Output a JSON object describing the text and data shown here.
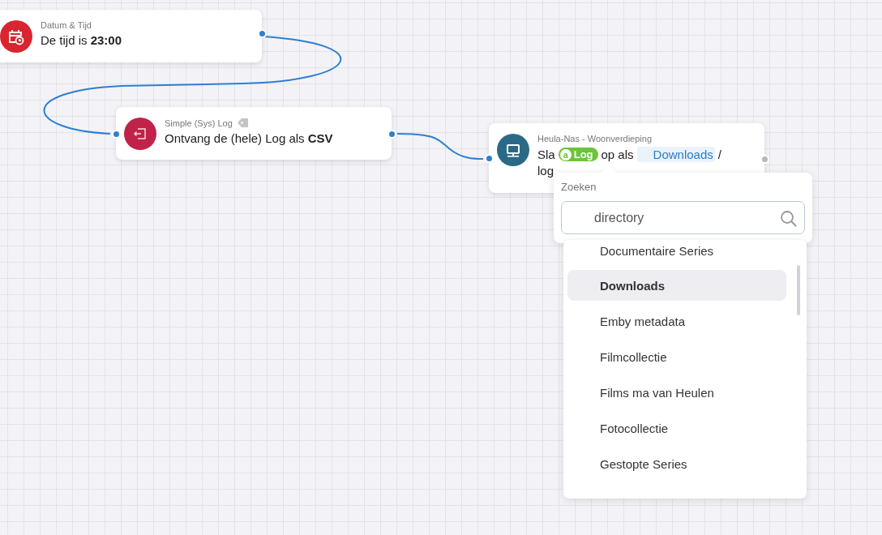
{
  "nodes": [
    {
      "kind": "time",
      "category": "Datum & Tijd",
      "tag_icon": false,
      "color": "#d9252f",
      "output_connected": true,
      "parts": [
        {
          "kind": "text",
          "text": "De tijd is **23:00**"
        }
      ]
    },
    {
      "kind": "log",
      "category": "Simple (Sys) Log",
      "tag_icon": true,
      "color": "#c0224a",
      "output_connected": true,
      "parts": [
        {
          "kind": "text",
          "text": "Ontvang de (hele) Log als **CSV**"
        }
      ]
    },
    {
      "kind": "nas",
      "category": "Heula-Nas - Woonverdieping",
      "tag_icon": false,
      "color": "#2b6a86",
      "output_connected": false,
      "parts": [
        {
          "kind": "text",
          "text": "Sla"
        },
        {
          "kind": "tag",
          "prefix": "a",
          "text": "Log"
        },
        {
          "kind": "text",
          "text": "op als"
        },
        {
          "kind": "value",
          "text": "Downloads"
        },
        {
          "kind": "text",
          "text": "/"
        },
        {
          "kind": "text",
          "text": "log"
        }
      ]
    }
  ],
  "picker": {
    "label": "Zoeken",
    "search": {
      "value": "directory"
    },
    "options": [
      {
        "label": "Documentaire Series",
        "selected": false
      },
      {
        "label": "Downloads",
        "selected": true
      },
      {
        "label": "Emby metadata",
        "selected": false
      },
      {
        "label": "Filmcollectie",
        "selected": false
      },
      {
        "label": "Films ma van Heulen",
        "selected": false
      },
      {
        "label": "Fotocollectie",
        "selected": false
      },
      {
        "label": "Gestopte Series",
        "selected": false
      }
    ]
  }
}
